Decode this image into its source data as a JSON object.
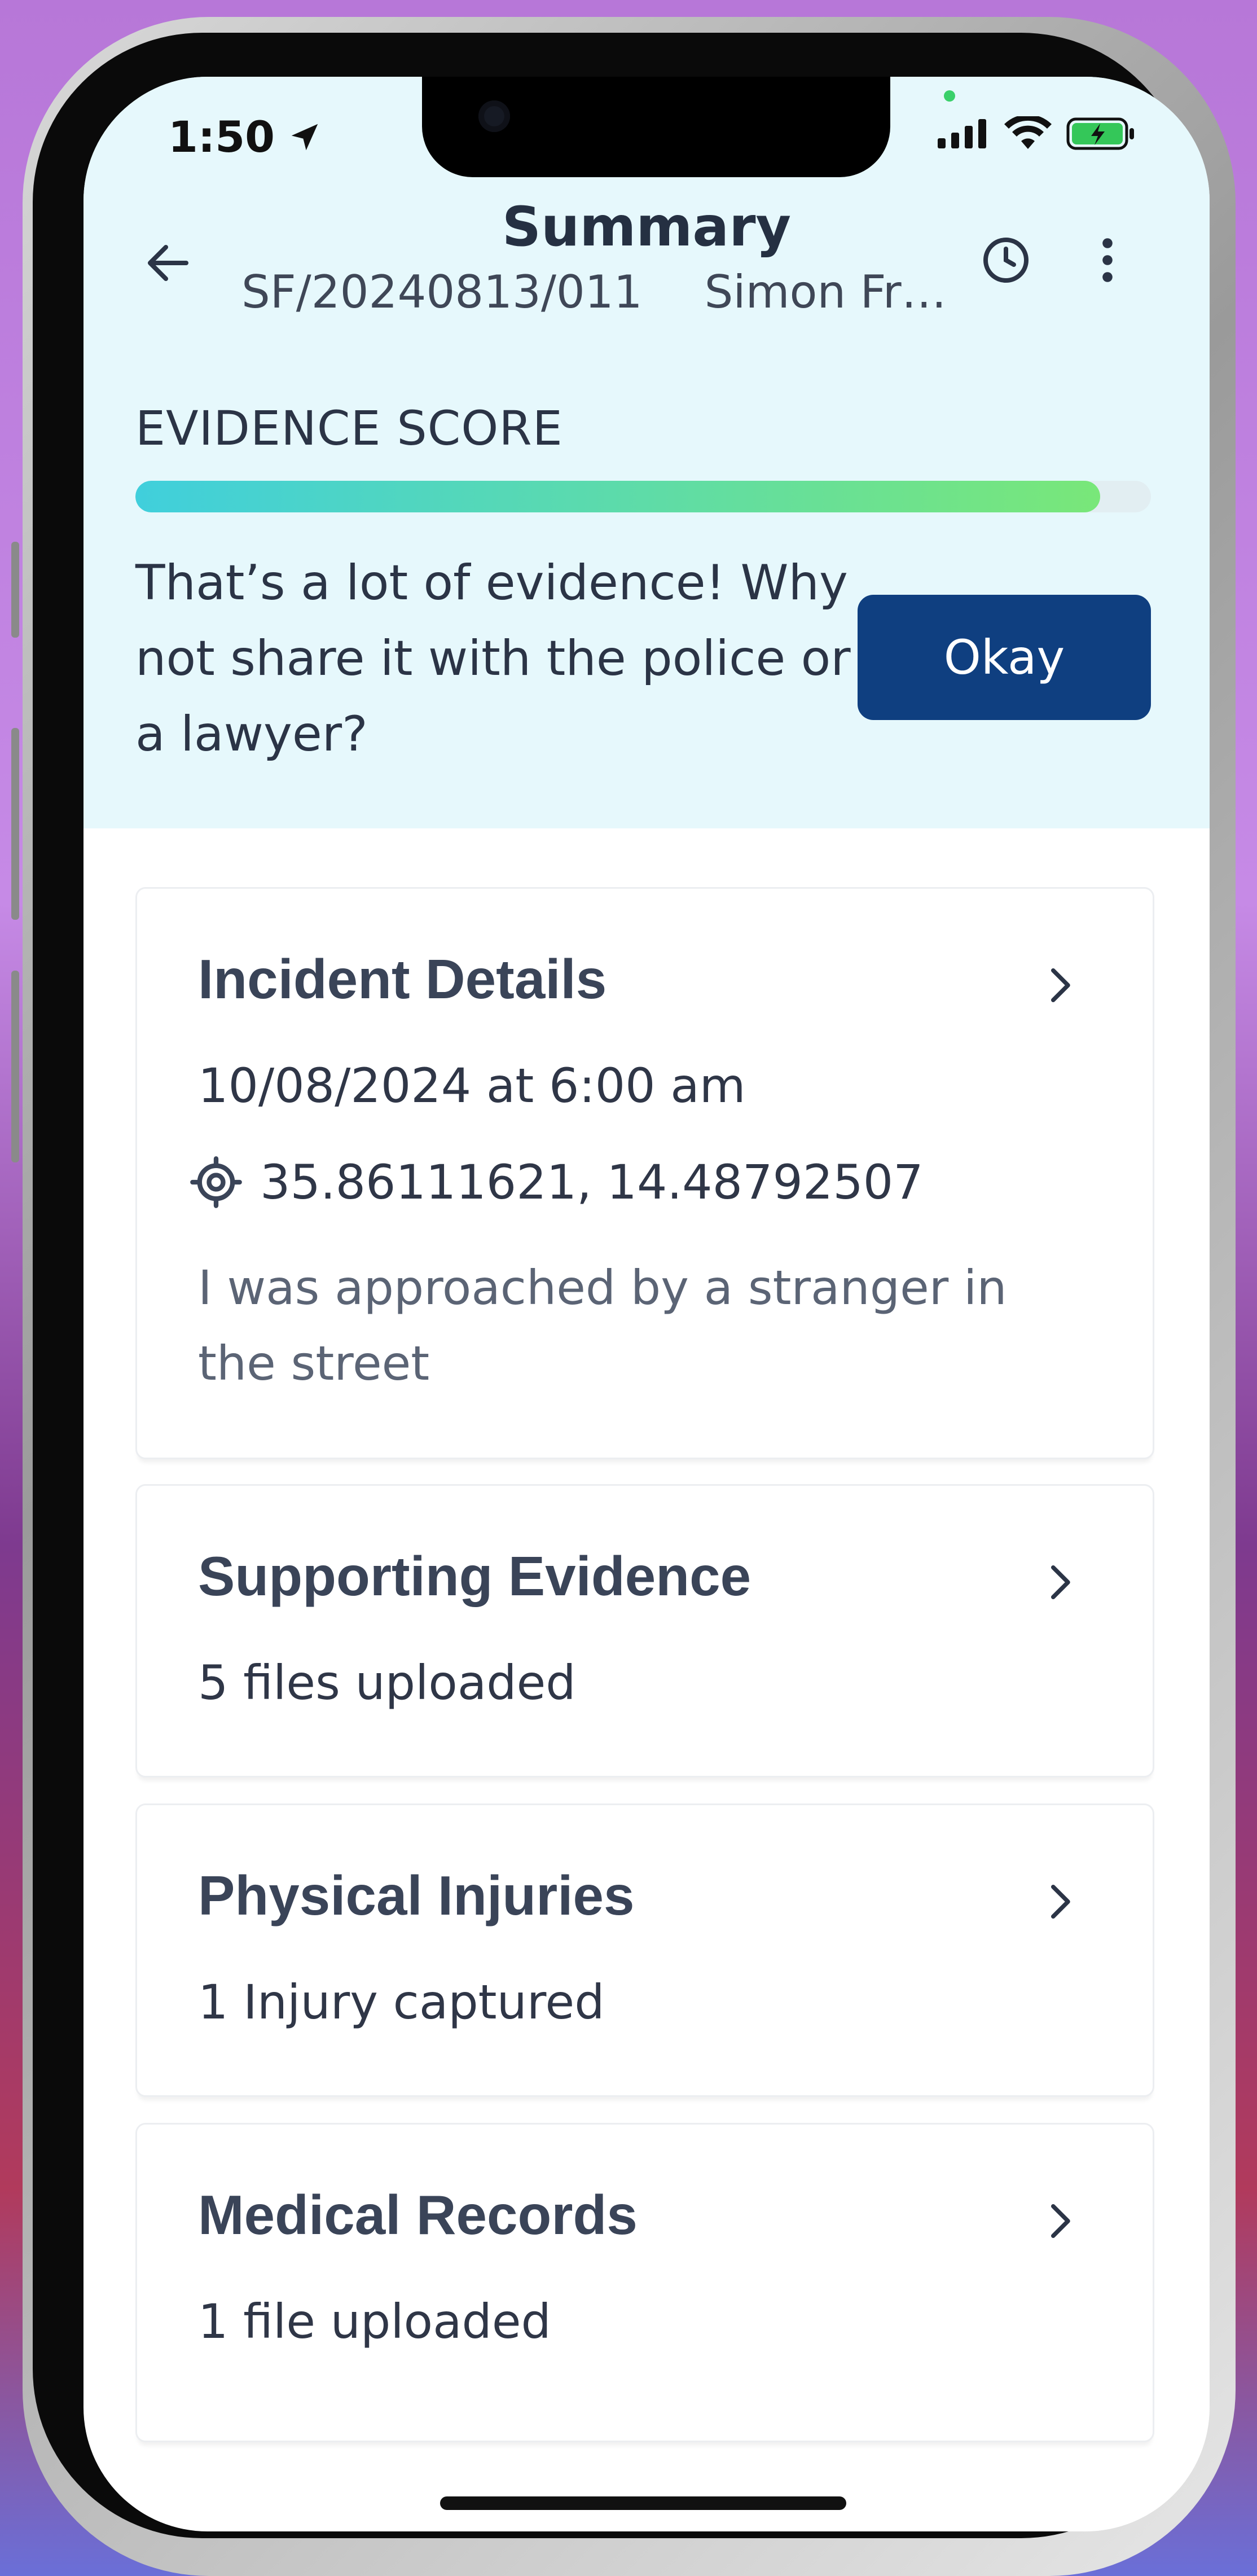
{
  "status_bar": {
    "time": "1:50",
    "location_icon": "location-arrow-icon",
    "signal_icon": "cellular-signal-icon",
    "wifi_icon": "wifi-icon",
    "battery_icon": "battery-charging-icon"
  },
  "header": {
    "title": "Summary",
    "case_id": "SF/20240813/011",
    "user_name": "Simon Fr…",
    "back_icon": "arrow-left-icon",
    "history_icon": "clock-icon",
    "more_icon": "more-vertical-icon"
  },
  "evidence": {
    "label": "EVIDENCE SCORE",
    "progress_fraction": 0.95,
    "message": "That’s a lot of evidence! Why not share it with the police or a lawyer?",
    "okay_label": "Okay"
  },
  "cards": {
    "incident": {
      "title": "Incident Details",
      "datetime": "10/08/2024 at 6:00 am",
      "location": "35.86111621, 14.48792507",
      "description": "I was approached by a stranger in the street"
    },
    "supporting": {
      "title": "Supporting Evidence",
      "summary": "5 files uploaded"
    },
    "injuries": {
      "title": "Physical Injuries",
      "summary": "1 Injury captured"
    },
    "medical": {
      "title": "Medical Records",
      "summary": "1 file uploaded"
    }
  },
  "colors": {
    "header_bg": "#e6f8fc",
    "primary_button": "#0f3f80",
    "progress_start": "#40cfdc",
    "progress_end": "#79e779"
  }
}
